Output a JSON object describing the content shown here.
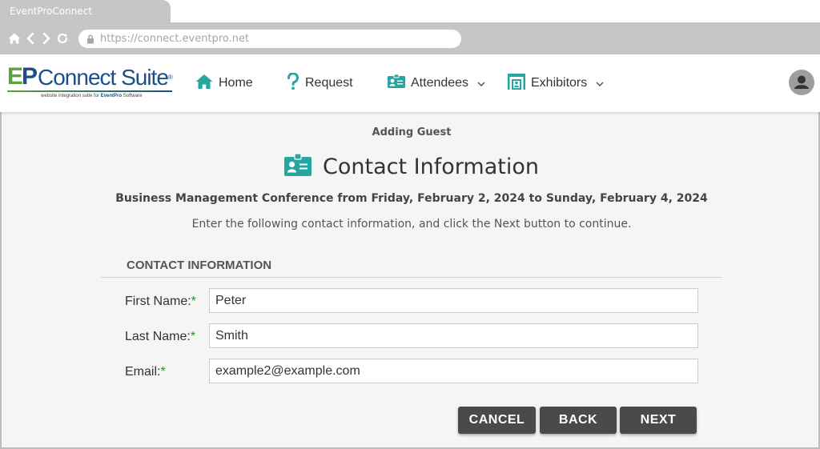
{
  "browser": {
    "tab_title": "EventProConnect",
    "url": "https://connect.eventpro.net"
  },
  "header": {
    "logo_text": "EPConnect Suite",
    "logo_tagline": "website integration suite for EventPro Software",
    "nav": [
      {
        "label": "Home",
        "icon": "home-icon",
        "has_dropdown": false
      },
      {
        "label": "Request",
        "icon": "question-icon",
        "has_dropdown": false
      },
      {
        "label": "Attendees",
        "icon": "id-card-icon",
        "has_dropdown": true
      },
      {
        "label": "Exhibitors",
        "icon": "booth-icon",
        "has_dropdown": true
      }
    ],
    "avatar_icon": "user-avatar-icon"
  },
  "page": {
    "subtitle": "Adding Guest",
    "title": "Contact Information",
    "event_line": "Business Management Conference from Friday, February 2, 2024 to Sunday, February 4, 2024",
    "instructions": "Enter the following contact information, and click the Next button to continue."
  },
  "form": {
    "section_title": "CONTACT INFORMATION",
    "required_marker": "*",
    "fields": [
      {
        "label": "First Name:",
        "value": "Peter"
      },
      {
        "label": "Last Name:",
        "value": "Smith"
      },
      {
        "label": "Email:",
        "value": "example2@example.com"
      }
    ]
  },
  "buttons": {
    "cancel": "CANCEL",
    "back": "BACK",
    "next": "NEXT"
  },
  "colors": {
    "accent_teal": "#26a6a0",
    "button_bg": "#4a4a4a",
    "required_green": "#2f8a2f",
    "browser_chrome": "#c6c6c6"
  }
}
